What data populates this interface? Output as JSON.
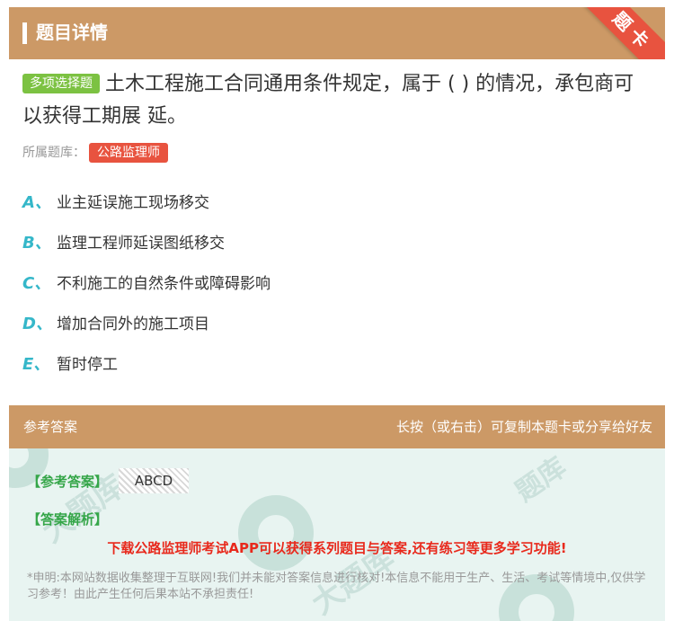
{
  "header": {
    "title": "题目详情",
    "ribbon": "题卡"
  },
  "question": {
    "type_tag": "多项选择题",
    "text": "土木工程施工合同通用条件规定，属于 ( ) 的情况，承包商可以获得工期展 延。",
    "bank_label": "所属题库：",
    "bank_name": "公路监理师"
  },
  "options": [
    {
      "letter": "A、",
      "text": "业主延误施工现场移交"
    },
    {
      "letter": "B、",
      "text": "监理工程师延误图纸移交"
    },
    {
      "letter": "C、",
      "text": "不利施工的自然条件或障碍影响"
    },
    {
      "letter": "D、",
      "text": "增加合同外的施工项目"
    },
    {
      "letter": "E、",
      "text": "暂时停工"
    }
  ],
  "answer_bar": {
    "left": "参考答案",
    "right": "长按（或右击）可复制本题卡或分享给好友"
  },
  "answer": {
    "ref_label": "【参考答案】",
    "ref_value": "ABCD",
    "analysis_label": "【答案解析】",
    "promo": "下载公路监理师考试APP可以获得系列题目与答案,还有练习等更多学习功能!",
    "disclaimer": "*申明:本网站数据收集整理于互联网!我们并未能对答案信息进行核对!本信息不能用于生产、生活、考试等情境中,仅供学习参考！由此产生任何后果本站不承担责任!"
  },
  "colors": {
    "header_bg": "#cc9966",
    "ribbon": "#e8533f",
    "type_tag": "#7cc242",
    "option_letter": "#35b7c9",
    "answer_label": "#35a649",
    "promo": "#e8291c"
  }
}
